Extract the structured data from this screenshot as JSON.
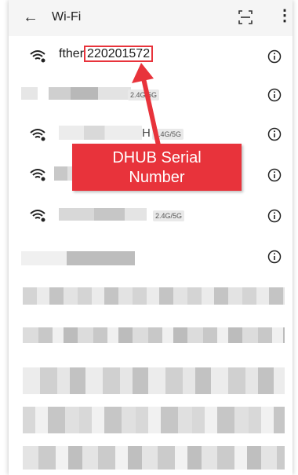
{
  "appbar": {
    "back_icon": "back-arrow-icon",
    "title": "Wi-Fi",
    "scan_icon": "qr-scan-icon",
    "more_icon": "more-vert-icon"
  },
  "networks": [
    {
      "ssid_prefix": "fther",
      "ssid_serial": "220201572",
      "band": ""
    },
    {
      "ssid_prefix": "",
      "ssid_serial": "",
      "band": "2.4G/5G"
    },
    {
      "ssid_prefix": "",
      "ssid_serial": "",
      "band": "2.4G/5G",
      "trailing": "H"
    },
    {
      "ssid_prefix": "",
      "ssid_serial": "",
      "band": ""
    },
    {
      "ssid_prefix": "",
      "ssid_serial": "",
      "band": "2.4G/5G"
    }
  ],
  "annotation": {
    "label": "DHUB Serial\nNumber",
    "line1": "DHUB Serial",
    "line2": "Number",
    "color": "#e8333b"
  }
}
